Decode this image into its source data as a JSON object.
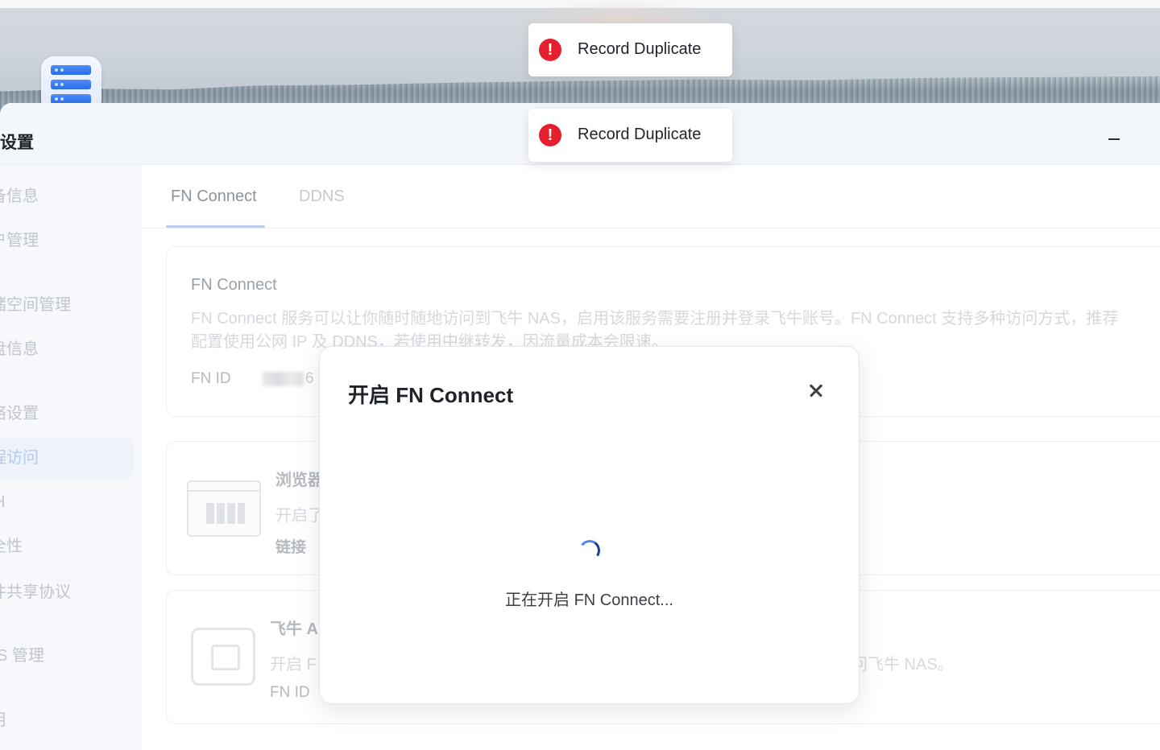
{
  "window": {
    "title": "统设置",
    "minimize_label": "–"
  },
  "sidebar": {
    "items": [
      {
        "label": "备信息"
      },
      {
        "label": "户管理"
      },
      {
        "label": "储空间管理"
      },
      {
        "label": "盘信息"
      },
      {
        "label": "络设置"
      },
      {
        "label": "程访问",
        "active": true
      },
      {
        "label": "H"
      },
      {
        "label": "全性"
      },
      {
        "label": "件共享协议"
      },
      {
        "label": "S 管理"
      },
      {
        "label": "用"
      }
    ]
  },
  "tabs": [
    {
      "label": "FN Connect",
      "active": true
    },
    {
      "label": "DDNS"
    }
  ],
  "fn_connect_card": {
    "title": "FN Connect",
    "description": "FN Connect 服务可以让你随时随地访问到飞牛 NAS，启用该服务需要注册并登录飞牛账号。FN Connect 支持多种访问方式，推荐配置使用公网 IP 及 DDNS，若使用中继转发，因流量成本会限速。",
    "fn_id_label": "FN ID",
    "fn_id_value_suffix": "6"
  },
  "browser_card": {
    "title": "浏览器",
    "description": "开启了",
    "link_label": "链接"
  },
  "app_card": {
    "title": "飞牛 A",
    "description_start": "开启 F",
    "description_end": "问飞牛 NAS。",
    "fn_id_label": "FN ID"
  },
  "modal": {
    "title": "开启 FN Connect",
    "loading_text": "正在开启 FN Connect..."
  },
  "toasts": [
    {
      "text": "Record Duplicate",
      "icon": "error-icon"
    },
    {
      "text": "Record Duplicate",
      "icon": "error-icon"
    }
  ],
  "colors": {
    "accent": "#2a6de8",
    "error": "#e5202e",
    "active_tab_underline": "#b8cdec"
  }
}
